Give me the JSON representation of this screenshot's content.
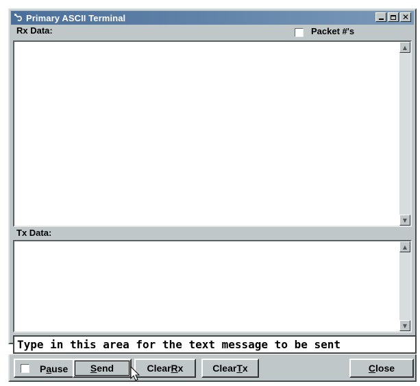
{
  "window": {
    "title": "Primary ASCII Terminal",
    "controls": [
      "minimize",
      "maximize",
      "close"
    ]
  },
  "rx": {
    "label": "Rx Data:",
    "packet_checkbox_label": "Packet #'s",
    "packet_checked": false,
    "content": ""
  },
  "tx": {
    "label": "Tx Data:",
    "content": ""
  },
  "message": {
    "value": "Type in this area for the text message to be sent"
  },
  "buttons": {
    "pause": {
      "prefix": "P",
      "underlined": "a",
      "suffix": "use",
      "checked": false
    },
    "send": {
      "underlined": "S",
      "rest": "end"
    },
    "clear_rx": {
      "prefix": "Clear ",
      "underlined": "R",
      "rest": "x"
    },
    "clear_tx": {
      "prefix": "Clear ",
      "underlined": "T",
      "rest": "x"
    },
    "close": {
      "underlined": "C",
      "rest": "lose"
    }
  },
  "icons": {
    "app": "terminal-plug-icon",
    "scroll_up": "scroll-up-arrow-icon",
    "scroll_down": "scroll-down-arrow-icon"
  }
}
